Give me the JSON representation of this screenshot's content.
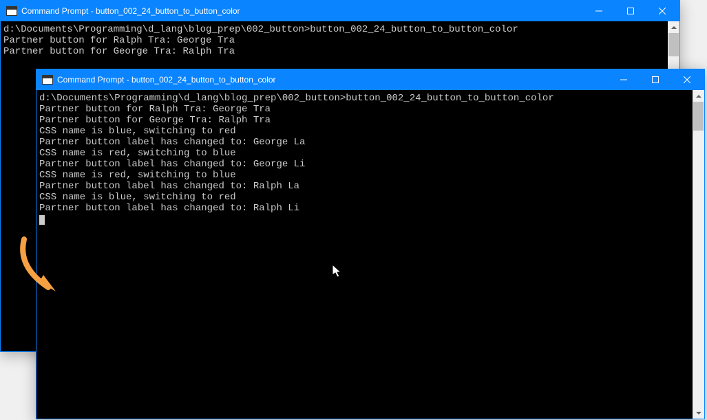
{
  "windows": {
    "back": {
      "title": "Command Prompt - button_002_24_button_to_button_color",
      "lines": [
        "d:\\Documents\\Programming\\d_lang\\blog_prep\\002_button>button_002_24_button_to_button_color",
        "Partner button for Ralph Tra: George Tra",
        "Partner button for George Tra: Ralph Tra"
      ]
    },
    "front": {
      "title": "Command Prompt - button_002_24_button_to_button_color",
      "lines": [
        "d:\\Documents\\Programming\\d_lang\\blog_prep\\002_button>button_002_24_button_to_button_color",
        "Partner button for Ralph Tra: George Tra",
        "Partner button for George Tra: Ralph Tra",
        "CSS name is blue, switching to red",
        "Partner button label has changed to: George La",
        "CSS name is red, switching to blue",
        "Partner button label has changed to: George Li",
        "CSS name is red, switching to blue",
        "Partner button label has changed to: Ralph La",
        "CSS name is blue, switching to red",
        "Partner button label has changed to: Ralph Li"
      ]
    }
  }
}
